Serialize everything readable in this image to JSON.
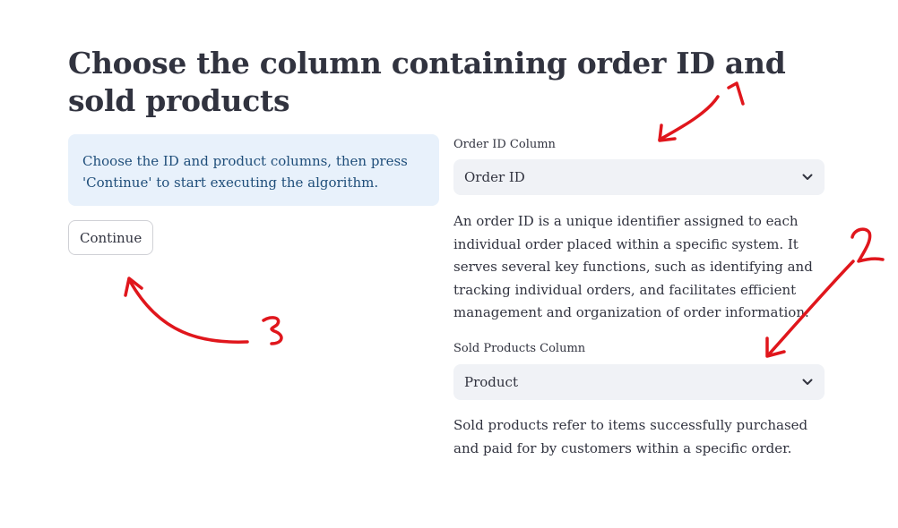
{
  "page": {
    "title": "Choose the column containing order ID and sold products"
  },
  "info": {
    "text": "Choose the ID and product columns, then press 'Continue' to start executing the algorithm."
  },
  "continue_button": {
    "label": "Continue"
  },
  "order_id": {
    "label": "Order ID Column",
    "selected": "Order ID",
    "description": "An order ID is a unique identifier assigned to each individual order placed within a specific system. It serves several key functions, such as identifying and tracking individual orders, and facilitates efficient management and organization of order information."
  },
  "sold_products": {
    "label": "Sold Products Column",
    "selected": "Product",
    "description": "Sold products refer to items successfully purchased and paid for by customers within a specific order."
  },
  "annotations": {
    "color": "#e0161c",
    "marks": [
      "1",
      "2",
      "3"
    ]
  },
  "icons": {
    "select_chevron": "chevron-down-icon"
  }
}
